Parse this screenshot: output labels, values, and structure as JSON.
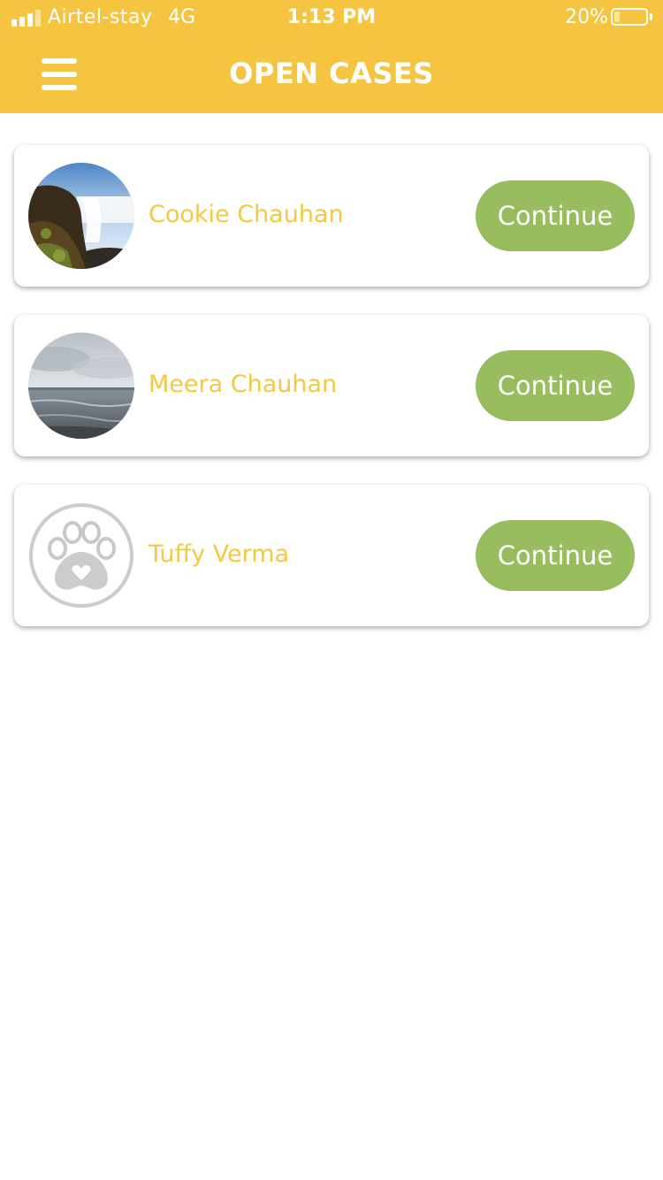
{
  "status_bar": {
    "carrier": "Airtel-stay",
    "network": "4G",
    "time": "1:13 PM",
    "battery": "20%"
  },
  "header": {
    "title": "OPEN CASES",
    "menu_icon": "hamburger-menu-icon",
    "background_color": "#f5c542"
  },
  "cases": [
    {
      "name": "Cookie Chauhan",
      "button_label": "Continue",
      "avatar": "waterfall-photo"
    },
    {
      "name": "Meera Chauhan",
      "button_label": "Continue",
      "avatar": "seaside-photo"
    },
    {
      "name": "Tuffy Verma",
      "button_label": "Continue",
      "avatar": "paw-placeholder-icon"
    }
  ],
  "colors": {
    "accent": "#f5c842",
    "button": "#98bd5e"
  }
}
